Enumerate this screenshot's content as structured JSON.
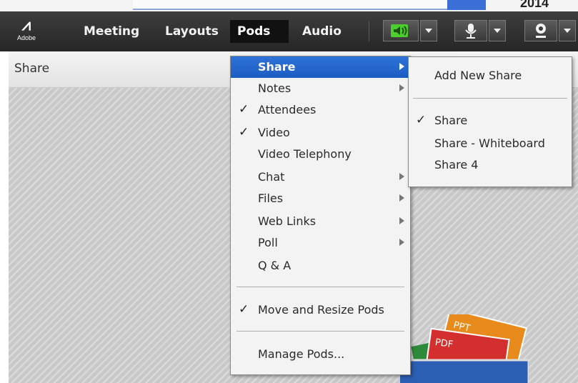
{
  "browser": {
    "year_fragment": "2014"
  },
  "app": {
    "logo_text": "Adobe"
  },
  "menubar": {
    "items": [
      {
        "label": "Meeting",
        "active": false
      },
      {
        "label": "Layouts",
        "active": false
      },
      {
        "label": "Pods",
        "active": true
      },
      {
        "label": "Audio",
        "active": false
      }
    ]
  },
  "toolbar": {
    "speaker_icon": "speaker-icon",
    "speaker_color": "#4ccf2c",
    "microphone_icon": "microphone-icon",
    "webcam_icon": "webcam-icon"
  },
  "pod": {
    "title": "Share"
  },
  "pods_menu": {
    "items": [
      {
        "label": "Share",
        "checked": false,
        "submenu": true,
        "highlighted": true
      },
      {
        "label": "Notes",
        "checked": false,
        "submenu": true
      },
      {
        "label": "Attendees",
        "checked": true,
        "submenu": false
      },
      {
        "label": "Video",
        "checked": true,
        "submenu": false
      },
      {
        "label": "Video Telephony",
        "checked": false,
        "submenu": false
      },
      {
        "label": "Chat",
        "checked": false,
        "submenu": true
      },
      {
        "label": "Files",
        "checked": false,
        "submenu": true
      },
      {
        "label": "Web Links",
        "checked": false,
        "submenu": true
      },
      {
        "label": "Poll",
        "checked": false,
        "submenu": true
      },
      {
        "label": "Q & A",
        "checked": false,
        "submenu": false
      },
      {
        "label": "Move and Resize Pods",
        "checked": true,
        "submenu": false
      },
      {
        "label": "Manage Pods...",
        "checked": false,
        "submenu": false
      }
    ]
  },
  "share_submenu": {
    "items": [
      {
        "label": "Add New Share",
        "checked": false
      },
      {
        "label": "Share",
        "checked": true
      },
      {
        "label": "Share - Whiteboard",
        "checked": false
      },
      {
        "label": "Share 4",
        "checked": false
      }
    ]
  },
  "check_glyph": "✓",
  "accent_color": "#1b5cc3",
  "pod_graphic": {
    "badges": [
      "PPT",
      "PDF"
    ]
  }
}
